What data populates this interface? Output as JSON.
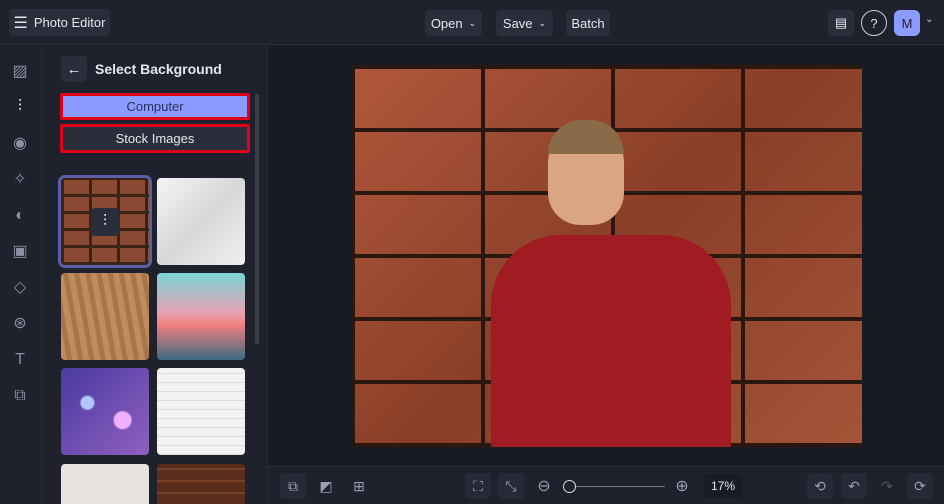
{
  "header": {
    "app_title": "Photo Editor",
    "open": "Open",
    "save": "Save",
    "batch": "Batch",
    "avatar": "M"
  },
  "panel": {
    "title": "Select Background",
    "computer": "Computer",
    "stock_images": "Stock Images"
  },
  "bottom": {
    "zoom": "17%"
  },
  "colors": {
    "accent": "#8c9bff",
    "highlight": "#e0001a"
  }
}
